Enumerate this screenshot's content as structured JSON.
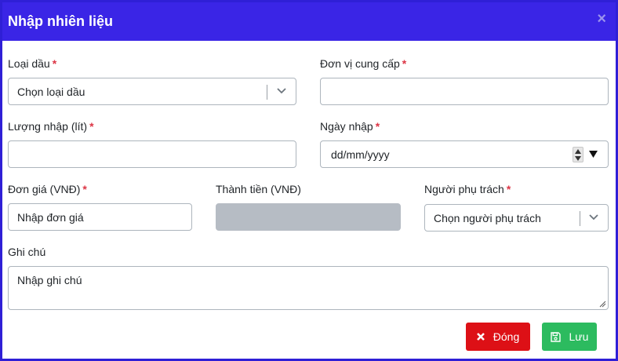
{
  "modal": {
    "title": "Nhập nhiên liệu",
    "close_glyph": "×"
  },
  "fields": {
    "fuel_type": {
      "label": "Loại dầu",
      "required_mark": "*",
      "value": "Chọn loại dầu"
    },
    "supplier": {
      "label": "Đơn vị cung cấp",
      "required_mark": "*",
      "value": ""
    },
    "quantity": {
      "label": "Lượng nhập (lít)",
      "required_mark": "*",
      "value": ""
    },
    "import_date": {
      "label": "Ngày nhập",
      "required_mark": "*",
      "value": "dd/mm/yyyy"
    },
    "unit_price": {
      "label": "Đơn giá (VNĐ)",
      "required_mark": "*",
      "value": "Nhập đơn giá"
    },
    "total": {
      "label": "Thành tiền (VNĐ)",
      "value": ""
    },
    "person_in_charge": {
      "label": "Người phụ trách",
      "required_mark": "*",
      "value": "Chọn người phụ trách"
    },
    "note": {
      "label": "Ghi chú",
      "value": "Nhập ghi chú"
    }
  },
  "buttons": {
    "close": {
      "label": "Đóng",
      "icon": "x-icon",
      "color": "#dd1016"
    },
    "save": {
      "label": "Lưu",
      "icon": "floppy-disk-icon",
      "color": "#2cbb5f"
    }
  },
  "colors": {
    "header": "#3a25e6",
    "required": "#dc3545",
    "disabled_field": "#b6bcc4"
  }
}
